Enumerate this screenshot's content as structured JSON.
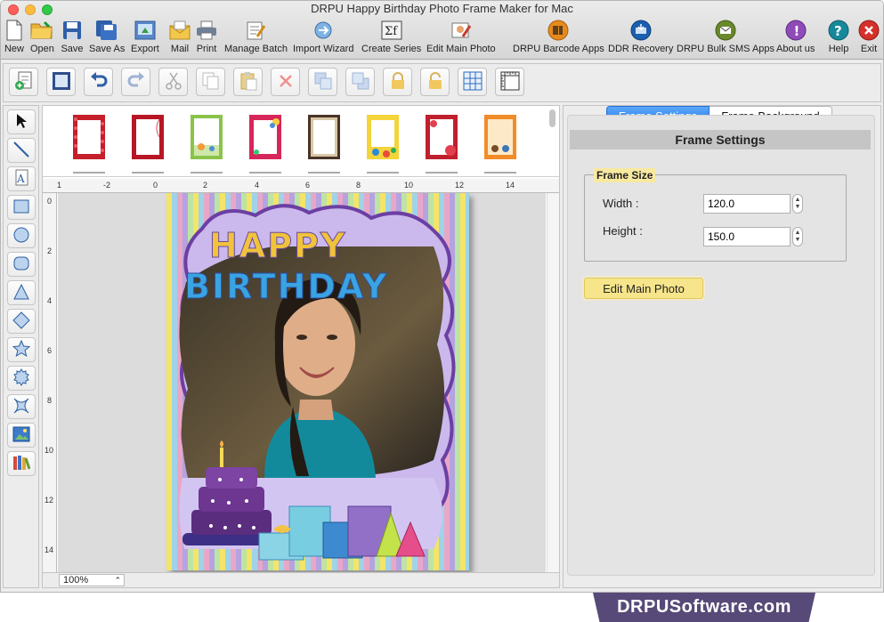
{
  "window": {
    "title": "DRPU Happy Birthday Photo Frame Maker for Mac"
  },
  "toolbar": {
    "items": [
      {
        "label": "New",
        "icon": "new-file-icon"
      },
      {
        "label": "Open",
        "icon": "folder-icon"
      },
      {
        "label": "Save",
        "icon": "save-icon"
      },
      {
        "label": "Save As",
        "icon": "save-as-icon"
      },
      {
        "label": "Export",
        "icon": "export-icon"
      },
      {
        "label": "Mail",
        "icon": "mail-icon"
      },
      {
        "label": "Print",
        "icon": "printer-icon"
      },
      {
        "label": "Manage Batch",
        "icon": "manage-batch-icon"
      },
      {
        "label": "Import Wizard",
        "icon": "import-wizard-icon"
      },
      {
        "label": "Create Series",
        "icon": "create-series-icon"
      },
      {
        "label": "Edit Main Photo",
        "icon": "edit-photo-icon"
      },
      {
        "label": "DRPU Barcode Apps",
        "icon": "barcode-icon"
      },
      {
        "label": "DDR Recovery",
        "icon": "recovery-icon"
      },
      {
        "label": "DRPU Bulk SMS Apps",
        "icon": "sms-icon"
      },
      {
        "label": "About us",
        "icon": "about-icon"
      },
      {
        "label": "Help",
        "icon": "help-icon"
      },
      {
        "label": "Exit",
        "icon": "exit-icon"
      }
    ]
  },
  "ruler": {
    "top": [
      "1",
      "-2",
      "0",
      "2",
      "4",
      "6",
      "8",
      "10",
      "12",
      "14"
    ],
    "left": [
      "0",
      "2",
      "4",
      "6",
      "8",
      "10",
      "12",
      "14"
    ]
  },
  "canvas": {
    "zoom": "100%",
    "frame_text_line1": "HAPPY",
    "frame_text_line2": "BIRTHDAY"
  },
  "right_panel": {
    "tabs": [
      "Frame Settings",
      "Frame Background"
    ],
    "section_title": "Frame Settings",
    "group_title": "Frame Size",
    "width_label": "Width :",
    "width_value": "120.0",
    "height_label": "Height :",
    "height_value": "150.0",
    "edit_button": "Edit Main Photo"
  },
  "brand": {
    "text": "DRPUSoftware.com"
  },
  "colors": {
    "accent_blue": "#2a7ef0",
    "button_yellow": "#f6e58a",
    "brand_purple": "#574a78"
  }
}
